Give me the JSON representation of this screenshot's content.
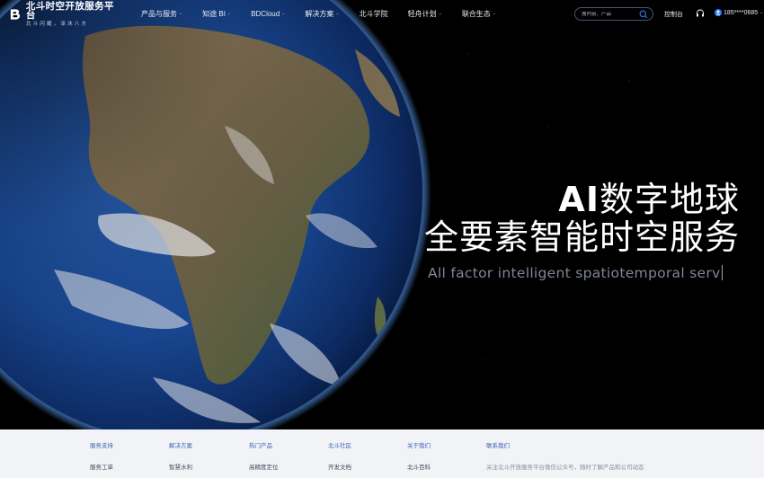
{
  "logo": {
    "title": "北斗时空开放服务平台",
    "subtitle": "北斗闪耀，泽沐八方"
  },
  "nav": {
    "items": [
      {
        "label": "产品与服务",
        "has_dropdown": true
      },
      {
        "label": "知途 BI",
        "has_dropdown": true
      },
      {
        "label": "BDCloud",
        "has_dropdown": true
      },
      {
        "label": "解决方案",
        "has_dropdown": true
      },
      {
        "label": "北斗学院",
        "has_dropdown": false
      },
      {
        "label": "轻舟计划",
        "has_dropdown": true
      },
      {
        "label": "联合生态",
        "has_dropdown": true
      }
    ],
    "search_placeholder": "搜内容、产品",
    "console": "控制台",
    "user_phone": "185****0685"
  },
  "hero": {
    "title_line1_bold": "AI",
    "title_line1_rest": "数字地球",
    "title_line2": "全要素智能时空服务",
    "subtitle": "All factor intelligent spatiotemporal serv"
  },
  "footer": {
    "columns": [
      {
        "heading": "服务支持",
        "link": "服务工单"
      },
      {
        "heading": "解决方案",
        "link": "智慧水利"
      },
      {
        "heading": "热门产品",
        "link": "高精度定位"
      },
      {
        "heading": "北斗社区",
        "link": "开发文档"
      },
      {
        "heading": "关于我们",
        "link": "北斗百科"
      }
    ],
    "contact": {
      "heading": "联系我们",
      "text": "关注北斗开放服务平台微信公众号，随时了解产品和公司动态"
    }
  },
  "colors": {
    "accent": "#3d63b7",
    "footer_bg": "#f1f3f7",
    "search_icon": "#2f7cf6"
  }
}
